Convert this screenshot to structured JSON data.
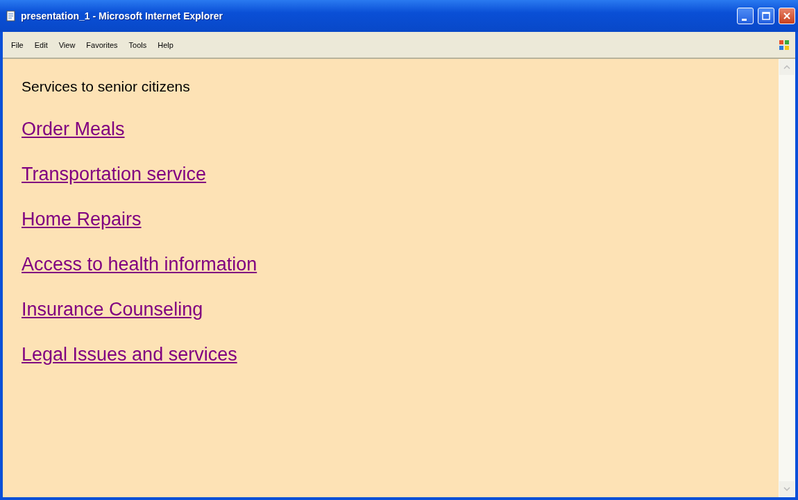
{
  "window": {
    "title": "presentation_1 - Microsoft Internet Explorer"
  },
  "menu": [
    "File",
    "Edit",
    "View",
    "Favorites",
    "Tools",
    "Help"
  ],
  "heading": "Services to senior citizens",
  "links": [
    {
      "label": "Order Meals"
    },
    {
      "label": "Transportation service"
    },
    {
      "label": "Home Repairs"
    },
    {
      "label": "Access to health information"
    },
    {
      "label": "Insurance Counseling"
    },
    {
      "label": "Legal Issues and services"
    }
  ]
}
